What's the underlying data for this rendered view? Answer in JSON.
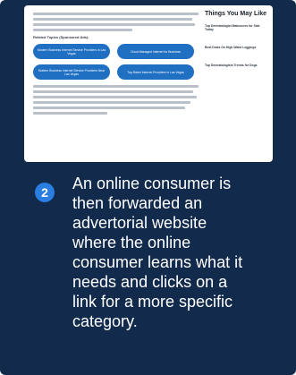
{
  "screenshot": {
    "heading": "Related Topics (Sponsored Ads):",
    "pills": [
      [
        "Modern Business Internet Service Providers in Las Vegas",
        "Cloud Managed Internet for Business"
      ],
      [
        "Modern Business Internet Service Providers Near Las Vegas",
        "Top-Rated Internet Providers in Las Vegas"
      ]
    ],
    "sidebar_title": "Things You May Like",
    "sidebar_items": [
      "Top Dermatologist Makeovers for Sale Today",
      "Best Deals On High Waist Leggings",
      "Top Dermatologists Trends for Dogs"
    ]
  },
  "step": {
    "number": "2",
    "text": "An online consumer is\nthen forwarded an\nadvertorial website\nwhere the online\nconsumer learns what it\nneeds and clicks on a\nlink for a more specific\ncategory."
  },
  "colors": {
    "card_bg": "#122a4c",
    "badge_bg": "#2a7de1",
    "pill_bg": "#1f6fc2"
  }
}
